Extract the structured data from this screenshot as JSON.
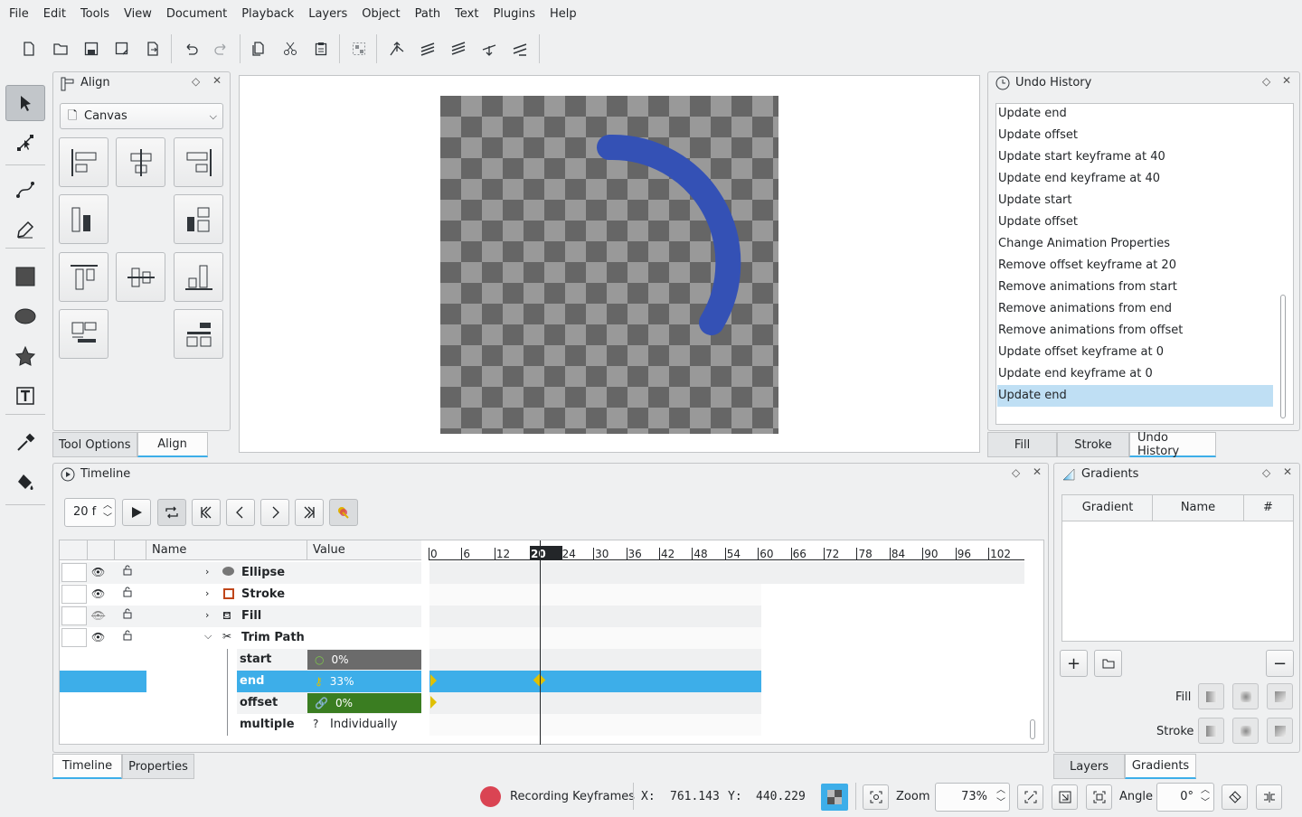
{
  "menu": [
    "File",
    "Edit",
    "Tools",
    "View",
    "Document",
    "Playback",
    "Layers",
    "Object",
    "Path",
    "Text",
    "Plugins",
    "Help"
  ],
  "align_panel": {
    "title": "Align",
    "relative_to": "Canvas"
  },
  "left_tabs": [
    "Tool Options",
    "Align"
  ],
  "undo_history": {
    "title": "Undo History",
    "items": [
      "Update end",
      "Update offset",
      "Update start keyframe at 40",
      "Update end keyframe at 40",
      "Update start",
      "Update offset",
      "Change Animation Properties",
      "Remove offset keyframe at 20",
      "Remove animations from start",
      "Remove animations from end",
      "Remove animations from offset",
      "Update offset keyframe at 0",
      "Update end keyframe at 0",
      "Update end"
    ],
    "selected_index": 13
  },
  "right_tabs": [
    "Fill",
    "Stroke",
    "Undo History"
  ],
  "timeline": {
    "title": "Timeline",
    "frame": "20 f",
    "columns": {
      "name": "Name",
      "value": "Value"
    },
    "layers": [
      {
        "name": "Ellipse",
        "kind": "ellipse"
      },
      {
        "name": "Stroke",
        "kind": "stroke"
      },
      {
        "name": "Fill",
        "kind": "fill"
      },
      {
        "name": "Trim Path",
        "kind": "trim"
      }
    ],
    "props": [
      {
        "name": "start",
        "value": "0%",
        "color": "#6b6b6b"
      },
      {
        "name": "end",
        "value": "33%",
        "color": "#3daee9"
      },
      {
        "name": "offset",
        "value": "0%",
        "color": "#3a7d21"
      },
      {
        "name": "multiple",
        "value": "Individually",
        "color": ""
      }
    ],
    "ruler": [
      "0",
      "6",
      "12",
      "20",
      "24",
      "30",
      "36",
      "42",
      "48",
      "54",
      "60",
      "66",
      "72",
      "78",
      "84",
      "90",
      "96",
      "102"
    ],
    "current_frame": "20"
  },
  "bottom_tabs": [
    "Timeline",
    "Properties"
  ],
  "gradients": {
    "title": "Gradients",
    "columns": [
      "Gradient",
      "Name",
      "#"
    ],
    "fill_label": "Fill",
    "stroke_label": "Stroke"
  },
  "gradient_tabs": [
    "Layers",
    "Gradients"
  ],
  "status": {
    "recording": "Recording Keyframes",
    "x_label": "X:",
    "x": "761.143",
    "y_label": "Y:",
    "y": "440.229",
    "zoom_label": "Zoom",
    "zoom": "73%",
    "angle_label": "Angle",
    "angle": "0°"
  },
  "colors": {
    "accent": "#3daee9",
    "arc": "#3451b5",
    "record": "#da4453"
  }
}
